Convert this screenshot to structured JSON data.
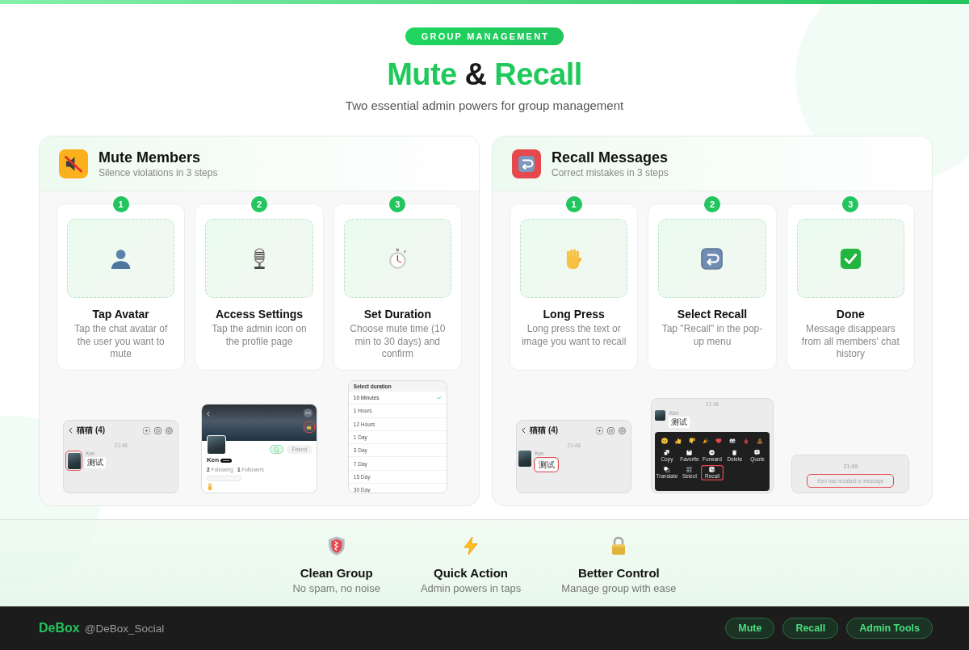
{
  "header": {
    "badge": "GROUP MANAGEMENT",
    "title": [
      {
        "text": "Mute",
        "accent": true
      },
      {
        "text": "&",
        "accent": false
      },
      {
        "text": "Recall",
        "accent": true
      }
    ],
    "subtitle": "Two essential admin powers for group management"
  },
  "panels": [
    {
      "title": "Mute Members",
      "subtitle": "Silence violations in 3 steps",
      "steps": [
        {
          "number": "1",
          "title": "Tap Avatar",
          "description": "Tap the chat avatar of the user you want to mute"
        },
        {
          "number": "2",
          "title": "Access Settings",
          "description": "Tap the admin icon on the profile page"
        },
        {
          "number": "3",
          "title": "Set Duration",
          "description": "Choose mute time (10 min to 30 days) and confirm"
        }
      ],
      "screens": [
        {
          "kind": "chat",
          "title": "猫猫 (4)",
          "time": "21:48",
          "sender": "Ken",
          "message": "测试",
          "avatar_highlighted": true,
          "bubble_highlighted": false
        },
        {
          "kind": "profile",
          "name": "Ken",
          "stats": [
            {
              "count": "2",
              "label": "Following"
            },
            {
              "count": "1",
              "label": "Followers"
            }
          ],
          "button": "Friend",
          "admin_icon_highlighted": true
        },
        {
          "kind": "duration_list",
          "title": "Select duration",
          "options": [
            {
              "label": "10 Minutes",
              "selected": true
            },
            {
              "label": "1 Hours",
              "selected": false
            },
            {
              "label": "12 Hours",
              "selected": false
            },
            {
              "label": "1 Day",
              "selected": false
            },
            {
              "label": "3 Day",
              "selected": false
            },
            {
              "label": "7 Day",
              "selected": false
            },
            {
              "label": "15 Day",
              "selected": false
            },
            {
              "label": "30 Day",
              "selected": false
            }
          ]
        }
      ]
    },
    {
      "title": "Recall Messages",
      "subtitle": "Correct mistakes in 3 steps",
      "steps": [
        {
          "number": "1",
          "title": "Long Press",
          "description": "Long press the text or image you want to recall"
        },
        {
          "number": "2",
          "title": "Select Recall",
          "description": "Tap \"Recall\" in the pop-up menu"
        },
        {
          "number": "3",
          "title": "Done",
          "description": "Message disappears from all members' chat history"
        }
      ],
      "screens": [
        {
          "kind": "chat",
          "title": "猫猫 (4)",
          "time": "21:48",
          "sender": "Ken",
          "message": "测试",
          "avatar_highlighted": false,
          "bubble_highlighted": true
        },
        {
          "kind": "menu",
          "time": "21:48",
          "sender": "Ken",
          "message": "测试",
          "actions": [
            {
              "label": "Copy",
              "highlighted": false
            },
            {
              "label": "Favorite",
              "highlighted": false
            },
            {
              "label": "Forward",
              "highlighted": false
            },
            {
              "label": "Delete",
              "highlighted": false
            },
            {
              "label": "Quote",
              "highlighted": false
            },
            {
              "label": "Translate",
              "highlighted": false
            },
            {
              "label": "Select",
              "highlighted": false
            },
            {
              "label": "Recall",
              "highlighted": true
            }
          ]
        },
        {
          "kind": "notice",
          "time": "21:49",
          "text": "Ken has recalled a message",
          "highlighted": true
        }
      ]
    }
  ],
  "features": [
    {
      "title": "Clean Group",
      "subtitle": "No spam, no noise"
    },
    {
      "title": "Quick Action",
      "subtitle": "Admin powers in taps"
    },
    {
      "title": "Better Control",
      "subtitle": "Manage group with ease"
    }
  ],
  "footer": {
    "brand": "DeBox",
    "handle": "@DeBox_Social",
    "tags": [
      "Mute",
      "Recall",
      "Admin Tools"
    ]
  }
}
